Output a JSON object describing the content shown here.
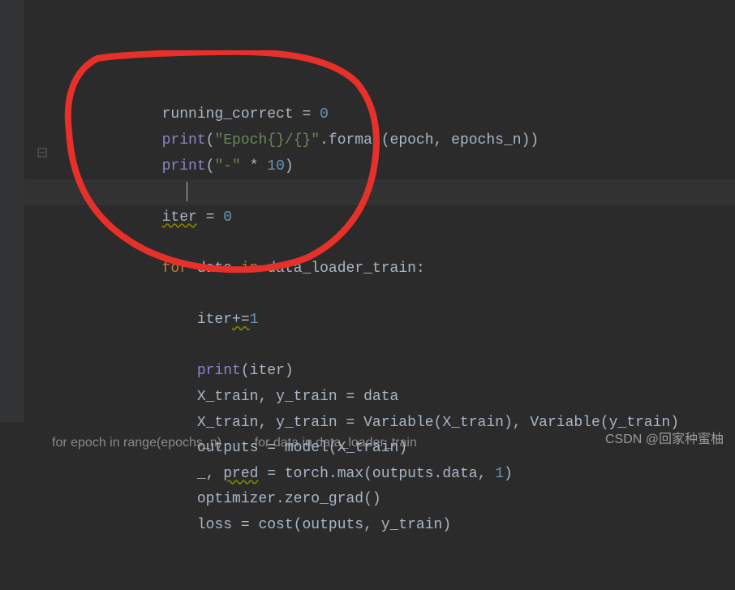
{
  "lines": [
    {
      "indent": 3,
      "tokens": [
        {
          "t": "ident",
          "v": "running_correct"
        },
        {
          "t": "op",
          "v": " = "
        },
        {
          "t": "number",
          "v": "0"
        }
      ]
    },
    {
      "indent": 3,
      "tokens": [
        {
          "t": "kw-print",
          "v": "print"
        },
        {
          "t": "op",
          "v": "("
        },
        {
          "t": "string",
          "v": "\"Epoch{}/{}\""
        },
        {
          "t": "op",
          "v": "."
        },
        {
          "t": "ident",
          "v": "format"
        },
        {
          "t": "op",
          "v": "("
        },
        {
          "t": "ident",
          "v": "epoch"
        },
        {
          "t": "op",
          "v": ", "
        },
        {
          "t": "ident",
          "v": "epochs_n"
        },
        {
          "t": "op",
          "v": "))"
        }
      ]
    },
    {
      "indent": 3,
      "tokens": [
        {
          "t": "kw-print",
          "v": "print"
        },
        {
          "t": "op",
          "v": "("
        },
        {
          "t": "string",
          "v": "\"-\""
        },
        {
          "t": "op",
          "v": " * "
        },
        {
          "t": "number",
          "v": "10"
        },
        {
          "t": "op",
          "v": ")"
        }
      ]
    },
    {
      "indent": 0,
      "tokens": []
    },
    {
      "indent": 3,
      "tokens": [
        {
          "t": "ident warn",
          "v": "iter"
        },
        {
          "t": "op",
          "v": " = "
        },
        {
          "t": "number",
          "v": "0"
        }
      ]
    },
    {
      "indent": 0,
      "tokens": []
    },
    {
      "indent": 3,
      "tokens": [
        {
          "t": "kw-for",
          "v": "for"
        },
        {
          "t": "op",
          "v": " "
        },
        {
          "t": "ident",
          "v": "data"
        },
        {
          "t": "op",
          "v": " "
        },
        {
          "t": "kw-in",
          "v": "in"
        },
        {
          "t": "op",
          "v": " "
        },
        {
          "t": "ident",
          "v": "data_loader_train"
        },
        {
          "t": "op",
          "v": ":"
        }
      ]
    },
    {
      "indent": 4,
      "tokens": []
    },
    {
      "indent": 4,
      "tokens": [
        {
          "t": "ident",
          "v": "iter"
        },
        {
          "t": "op warn",
          "v": "+="
        },
        {
          "t": "number",
          "v": "1"
        }
      ]
    },
    {
      "indent": 0,
      "tokens": []
    },
    {
      "indent": 4,
      "tokens": [
        {
          "t": "kw-print",
          "v": "print"
        },
        {
          "t": "op",
          "v": "("
        },
        {
          "t": "ident",
          "v": "iter"
        },
        {
          "t": "op",
          "v": ")"
        }
      ]
    },
    {
      "indent": 4,
      "tokens": [
        {
          "t": "ident",
          "v": "X_train"
        },
        {
          "t": "op",
          "v": ", "
        },
        {
          "t": "ident",
          "v": "y_train"
        },
        {
          "t": "op",
          "v": " = "
        },
        {
          "t": "ident",
          "v": "data"
        }
      ]
    },
    {
      "indent": 4,
      "tokens": [
        {
          "t": "ident",
          "v": "X_train"
        },
        {
          "t": "op",
          "v": ", "
        },
        {
          "t": "ident",
          "v": "y_train"
        },
        {
          "t": "op",
          "v": " = "
        },
        {
          "t": "ident",
          "v": "Variable"
        },
        {
          "t": "op",
          "v": "("
        },
        {
          "t": "ident",
          "v": "X_train"
        },
        {
          "t": "op",
          "v": "), "
        },
        {
          "t": "ident",
          "v": "Variable"
        },
        {
          "t": "op",
          "v": "("
        },
        {
          "t": "ident",
          "v": "y_train"
        },
        {
          "t": "op",
          "v": ")"
        }
      ]
    },
    {
      "indent": 4,
      "tokens": [
        {
          "t": "ident",
          "v": "outputs"
        },
        {
          "t": "op",
          "v": " = "
        },
        {
          "t": "ident",
          "v": "model"
        },
        {
          "t": "op",
          "v": "("
        },
        {
          "t": "ident",
          "v": "X_train"
        },
        {
          "t": "op",
          "v": ")"
        }
      ]
    },
    {
      "indent": 4,
      "tokens": [
        {
          "t": "ident",
          "v": "_"
        },
        {
          "t": "op",
          "v": ", "
        },
        {
          "t": "ident warn",
          "v": "pred"
        },
        {
          "t": "op",
          "v": " = "
        },
        {
          "t": "ident",
          "v": "torch"
        },
        {
          "t": "op",
          "v": "."
        },
        {
          "t": "ident",
          "v": "max"
        },
        {
          "t": "op",
          "v": "("
        },
        {
          "t": "ident",
          "v": "outputs"
        },
        {
          "t": "op",
          "v": "."
        },
        {
          "t": "ident",
          "v": "data"
        },
        {
          "t": "op",
          "v": ", "
        },
        {
          "t": "number",
          "v": "1"
        },
        {
          "t": "op",
          "v": ")"
        }
      ]
    },
    {
      "indent": 4,
      "tokens": [
        {
          "t": "ident",
          "v": "optimizer"
        },
        {
          "t": "op",
          "v": "."
        },
        {
          "t": "ident",
          "v": "zero_grad"
        },
        {
          "t": "op",
          "v": "()"
        }
      ]
    },
    {
      "indent": 4,
      "tokens": [
        {
          "t": "ident",
          "v": "loss"
        },
        {
          "t": "op",
          "v": " = "
        },
        {
          "t": "ident",
          "v": "cost"
        },
        {
          "t": "op",
          "v": "("
        },
        {
          "t": "ident",
          "v": "outputs"
        },
        {
          "t": "op",
          "v": ", "
        },
        {
          "t": "ident",
          "v": "y_train"
        },
        {
          "t": "op",
          "v": ")"
        }
      ]
    }
  ],
  "gutter": [
    "",
    "",
    "",
    "",
    "",
    "",
    "",
    "",
    "",
    "",
    "",
    "",
    "",
    "",
    "",
    "",
    ""
  ],
  "breadcrumb": {
    "item1": "for epoch in range(epochs_n)",
    "item2": "for data in data_loader_train"
  },
  "watermark": "CSDN @回家种蜜柚",
  "indent_unit": "    "
}
